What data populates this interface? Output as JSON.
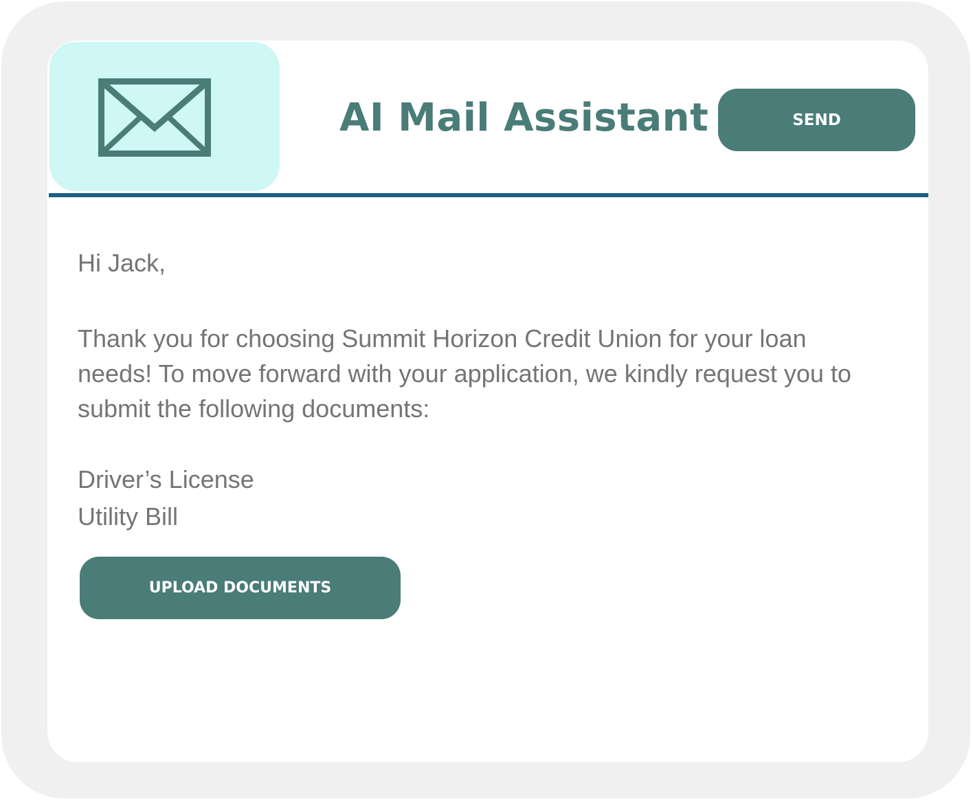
{
  "header": {
    "icon": "envelope-icon",
    "title": "AI Mail Assistant",
    "send_label": "SEND"
  },
  "email": {
    "greeting": "Hi Jack,",
    "message": "Thank you for choosing Summit Horizon Credit Union for your loan needs! To move forward with your application, we kindly request you to submit the following documents:",
    "documents": [
      "Driver’s License",
      "Utility Bill"
    ],
    "upload_label": "UPLOAD DOCUMENTS"
  },
  "colors": {
    "accent": "#4a7c78",
    "icon_tile": "#cff7f5",
    "divider": "#1b5f82",
    "body_text": "#747474",
    "frame": "#f0f0f0"
  }
}
